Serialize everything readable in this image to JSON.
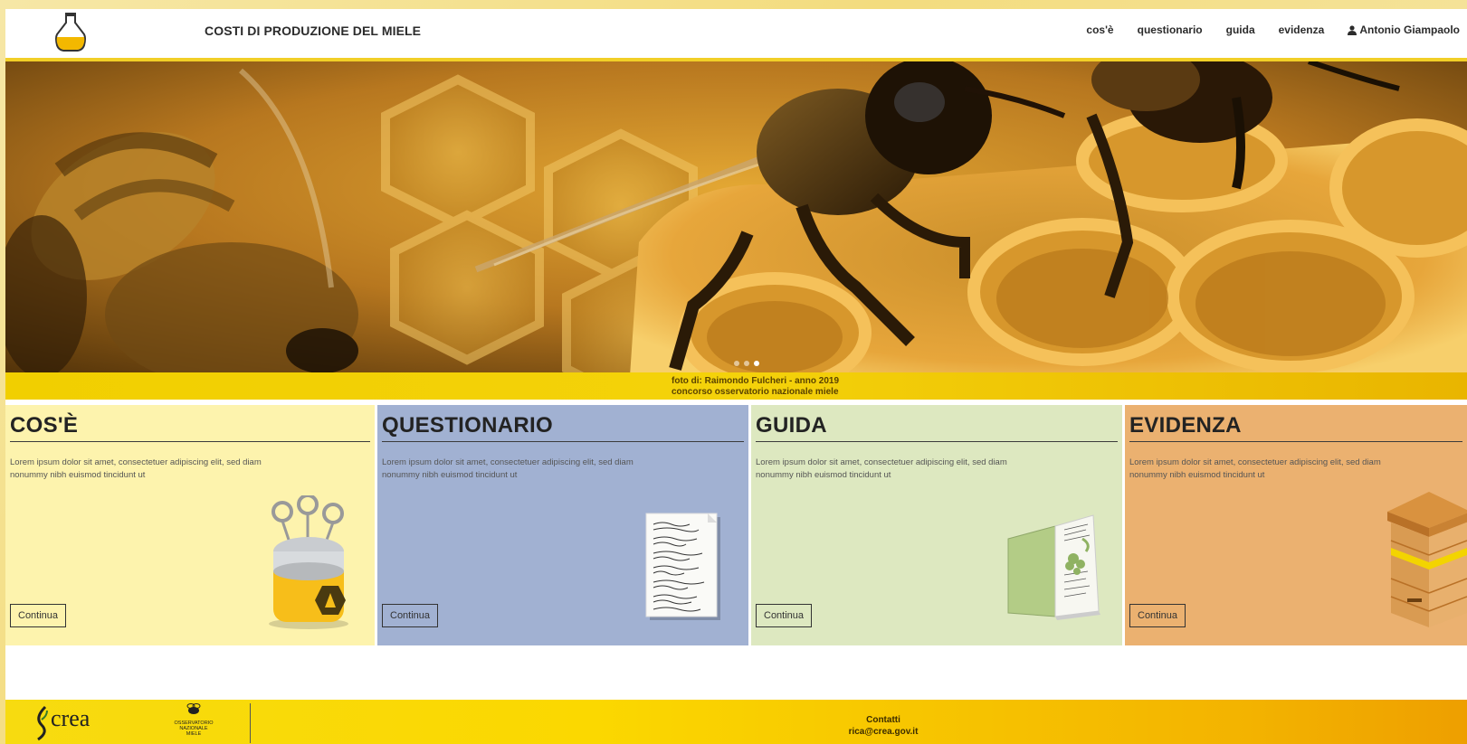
{
  "header": {
    "title": "COSTI DI PRODUZIONE DEL MIELE",
    "nav": [
      "cos'è",
      "questionario",
      "guida",
      "evidenza"
    ],
    "user": "Antonio Giampaolo"
  },
  "hero": {
    "caption_line1": "foto di: Raimondo Fulcheri - anno 2019",
    "caption_line2": "concorso osservatorio nazionale miele",
    "slides": 3,
    "active_slide": 3
  },
  "cards": [
    {
      "title": "COS'È",
      "text": "Lorem ipsum dolor sit amet, consectetuer adipiscing elit, sed diam nonummy nibh euismod tincidunt ut",
      "button": "Continua",
      "color": "#fdf3ad"
    },
    {
      "title": "QUESTIONARIO",
      "text": "Lorem ipsum dolor sit amet, consectetuer adipiscing elit, sed diam nonummy nibh euismod tincidunt ut",
      "button": "Continua",
      "color": "#a1b1d2"
    },
    {
      "title": "GUIDA",
      "text": "Lorem ipsum dolor sit amet, consectetuer adipiscing elit, sed diam nonummy nibh euismod tincidunt ut",
      "button": "Continua",
      "color": "#dde8c0"
    },
    {
      "title": "EVIDENZA",
      "text": "Lorem ipsum dolor sit amet, consectetuer adipiscing elit, sed diam nonummy nibh euismod tincidunt ut",
      "button": "Continua",
      "color": "#ebb170"
    }
  ],
  "footer": {
    "crea": "crea",
    "observatory": [
      "OSSERVATORIO",
      "NAZIONALE",
      "MIELE"
    ],
    "contacts_label": "Contatti",
    "email": "rica@crea.gov.it"
  },
  "colors": {
    "accent": "#f1cf27",
    "footer_start": "#f7db10",
    "footer_end": "#ee9f00"
  }
}
